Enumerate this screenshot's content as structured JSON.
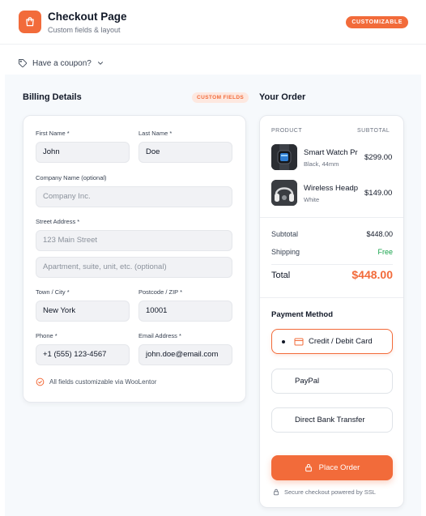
{
  "header": {
    "title": "Checkout Page",
    "subtitle": "Custom fields & layout",
    "badge": "CUSTOMIZABLE",
    "logo_icon": "shopping-bag-icon"
  },
  "coupon": {
    "label": "Have a coupon?"
  },
  "billing": {
    "title": "Billing Details",
    "badge": "CUSTOM FIELDS",
    "fields": {
      "first_name": {
        "label": "First Name *",
        "value": "John"
      },
      "last_name": {
        "label": "Last Name *",
        "value": "Doe"
      },
      "company": {
        "label": "Company Name (optional)",
        "placeholder": "Company Inc."
      },
      "street": {
        "label": "Street Address *",
        "placeholder": "123 Main Street"
      },
      "street2": {
        "placeholder": "Apartment, suite, unit, etc. (optional)"
      },
      "city": {
        "label": "Town / City *",
        "value": "New York"
      },
      "postcode": {
        "label": "Postcode / ZIP *",
        "value": "10001"
      },
      "phone": {
        "label": "Phone *",
        "value": "+1 (555) 123-4567"
      },
      "email": {
        "label": "Email Address *",
        "value": "john.doe@email.com"
      }
    },
    "note": "All fields customizable via WooLentor"
  },
  "order": {
    "title": "Your Order",
    "col_product": "PRODUCT",
    "col_subtotal": "SUBTOTAL",
    "items": [
      {
        "name": "Smart Watch Pro",
        "variant": "Black, 44mm",
        "price": "$299.00"
      },
      {
        "name": "Wireless Headphones",
        "variant": "White",
        "price": "$149.00"
      }
    ],
    "subtotal_label": "Subtotal",
    "subtotal_value": "$448.00",
    "shipping_label": "Shipping",
    "shipping_value": "Free",
    "total_label": "Total",
    "total_value": "$448.00"
  },
  "payment": {
    "title": "Payment Method",
    "options": [
      "Credit / Debit Card",
      "PayPal",
      "Direct Bank Transfer"
    ],
    "selected": "Credit / Debit Card"
  },
  "place_order": {
    "label": "Place Order"
  },
  "secure_note": "Secure checkout powered by SSL",
  "colors": {
    "accent": "#f26b3a",
    "success": "#16a34a",
    "background": "#f6f9fc"
  }
}
